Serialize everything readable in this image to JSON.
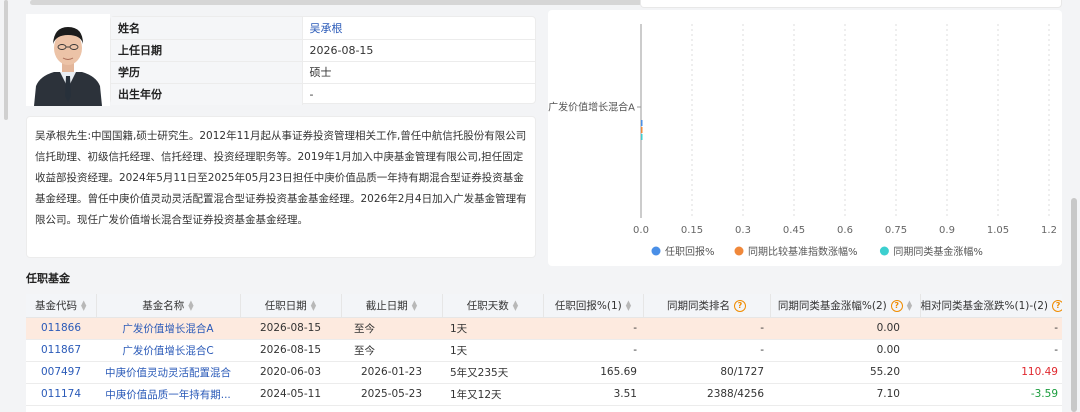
{
  "manager": {
    "fields": [
      {
        "label": "姓名",
        "value": "吴承根"
      },
      {
        "label": "上任日期",
        "value": "2026-08-15"
      },
      {
        "label": "学历",
        "value": "硕士"
      },
      {
        "label": "出生年份",
        "value": "-"
      }
    ],
    "bio": "吴承根先生:中国国籍,硕士研究生。2012年11月起从事证券投资管理相关工作,曾任中航信托股份有限公司信托助理、初级信托经理、信托经理、投资经理职务等。2019年1月加入中庚基金管理有限公司,担任固定收益部投资经理。2024年5月11日至2025年05月23日担任中庚价值品质一年持有期混合型证券投资基金基金经理。曾任中庚价值灵动灵活配置混合型证券投资基金基金经理。2026年2月4日加入广发基金管理有限公司。现任广发价值增长混合型证券投资基金基金经理。"
  },
  "chart_data": {
    "type": "bar",
    "orientation": "horizontal",
    "categories": [
      "广发价值增长混合A"
    ],
    "series": [
      {
        "name": "任职回报%",
        "color": "#4a8fe7",
        "values": [
          0.0
        ]
      },
      {
        "name": "同期比较基准指数涨幅%",
        "color": "#f0883a",
        "values": [
          0.0
        ]
      },
      {
        "name": "同期同类基金涨幅%",
        "color": "#3ccfcf",
        "values": [
          0.0
        ]
      }
    ],
    "xticks": [
      "0.0",
      "0.15",
      "0.3",
      "0.45",
      "0.6",
      "0.75",
      "0.9",
      "1.05",
      "1.2"
    ],
    "xlim": [
      0,
      1.2
    ],
    "legend_position": "bottom"
  },
  "section_title": "任职基金",
  "table": {
    "headers": [
      "基金代码",
      "基金名称",
      "任职日期",
      "截止日期",
      "任职天数",
      "任职回报%(1)",
      "同期同类排名",
      "同期同类基金涨幅%(2)",
      "相对同类基金涨跌%(1)-(2)"
    ],
    "rows": [
      [
        "011866",
        "广发价值增长混合A",
        "2026-08-15",
        "至今",
        "1天",
        "-",
        "-",
        "0.00",
        "-"
      ],
      [
        "011867",
        "广发价值增长混合C",
        "2026-08-15",
        "至今",
        "1天",
        "-",
        "-",
        "0.00",
        "-"
      ],
      [
        "007497",
        "中庚价值灵动灵活配置混合",
        "2020-06-03",
        "2026-01-23",
        "5年又235天",
        "165.69",
        "80/1727",
        "55.20",
        "110.49"
      ],
      [
        "011174",
        "中庚价值品质一年持有期...",
        "2024-05-11",
        "2025-05-23",
        "1年又12天",
        "3.51",
        "2388/4256",
        "7.10",
        "-3.59"
      ]
    ]
  },
  "icons": {
    "sort": "sort-icon",
    "help": "question-circle-icon"
  }
}
